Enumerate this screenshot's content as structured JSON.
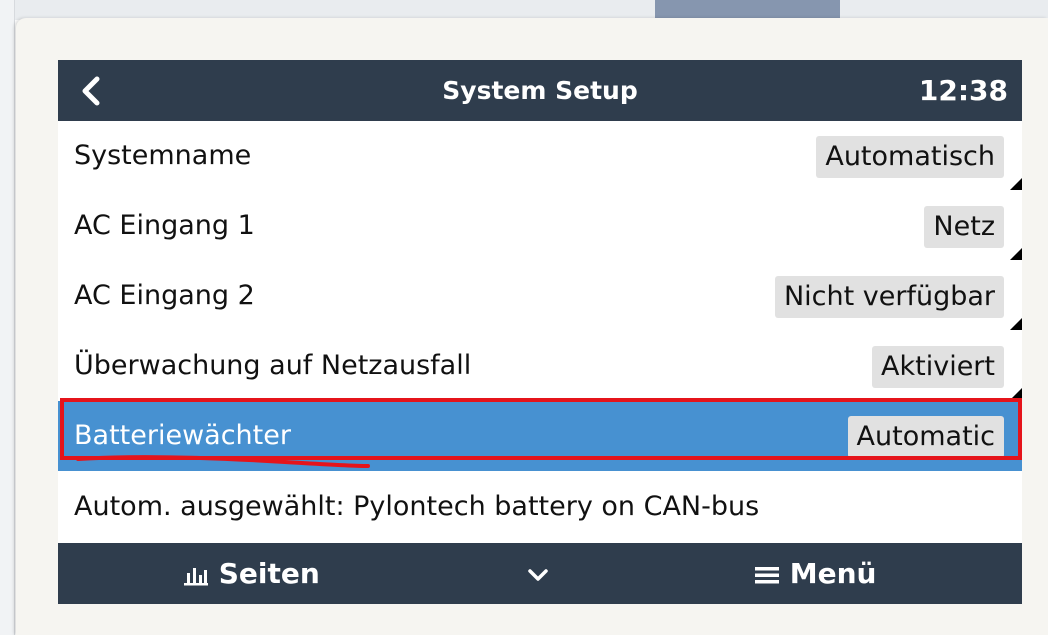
{
  "header": {
    "title": "System Setup",
    "time": "12:38"
  },
  "settings": [
    {
      "label": "Systemname",
      "value": "Automatisch"
    },
    {
      "label": "AC Eingang 1",
      "value": "Netz"
    },
    {
      "label": "AC Eingang 2",
      "value": "Nicht verfügbar"
    },
    {
      "label": "Überwachung auf Netzausfall",
      "value": "Aktiviert"
    },
    {
      "label": "Batteriewächter",
      "value": "Automatic",
      "selected": true
    }
  ],
  "info_line": "Autom. ausgewählt: Pylontech battery on CAN-bus",
  "footer": {
    "pages_label": "Seiten",
    "menu_label": "Menü"
  },
  "colors": {
    "bar": "#2f3d4d",
    "selected_row": "#4791d1",
    "annotation": "#e5141b"
  },
  "icons": [
    "back-chevron-icon",
    "bar-chart-icon",
    "chevron-down-icon",
    "hamburger-menu-icon"
  ]
}
